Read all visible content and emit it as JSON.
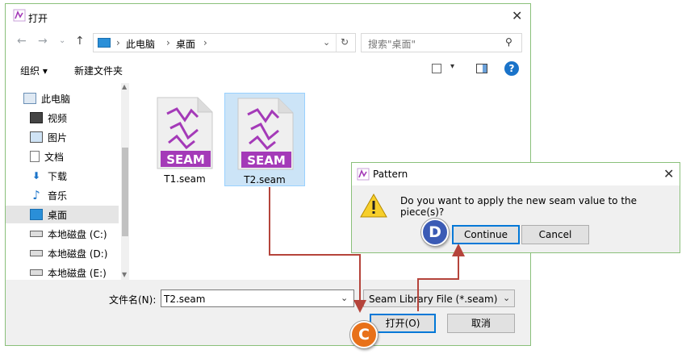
{
  "window": {
    "title": "打开"
  },
  "nav": {
    "back_icon": "arrow-left-icon",
    "forward_icon": "arrow-right-icon",
    "recent_icon": "chevron-down-icon",
    "up_icon": "arrow-up-icon"
  },
  "address": {
    "segments": [
      "此电脑",
      "桌面"
    ]
  },
  "search": {
    "placeholder": "搜索\"桌面\""
  },
  "toolbar": {
    "organize": "组织 ▾",
    "new_folder": "新建文件夹"
  },
  "sidebar": {
    "items": [
      {
        "label": "此电脑",
        "icon": "computer-icon"
      },
      {
        "label": "视频",
        "icon": "video-icon"
      },
      {
        "label": "图片",
        "icon": "picture-icon"
      },
      {
        "label": "文档",
        "icon": "document-icon"
      },
      {
        "label": "下载",
        "icon": "download-icon"
      },
      {
        "label": "音乐",
        "icon": "music-icon"
      },
      {
        "label": "桌面",
        "icon": "desktop-icon"
      },
      {
        "label": "本地磁盘 (C:)",
        "icon": "drive-icon"
      },
      {
        "label": "本地磁盘 (D:)",
        "icon": "drive-icon"
      },
      {
        "label": "本地磁盘 (E:)",
        "icon": "drive-icon"
      }
    ]
  },
  "files": [
    {
      "name": "T1.seam",
      "badge": "SEAM"
    },
    {
      "name": "T2.seam",
      "badge": "SEAM"
    }
  ],
  "bottom": {
    "filename_label": "文件名(N):",
    "filename_value": "T2.seam",
    "filetype": "Seam Library File (*.seam)",
    "open": "打开(O)",
    "cancel": "取消"
  },
  "pattern_dialog": {
    "title": "Pattern",
    "message": "Do you want to apply the new seam value to the piece(s)?",
    "continue": "Continue",
    "cancel": "Cancel"
  },
  "callouts": {
    "c": {
      "letter": "C",
      "color": "#e8711a"
    },
    "d": {
      "letter": "D",
      "color": "#3b5bb5"
    }
  },
  "colors": {
    "seam_purple": "#a43ab8",
    "arrow": "#b5443b",
    "accent": "#0078d7"
  }
}
